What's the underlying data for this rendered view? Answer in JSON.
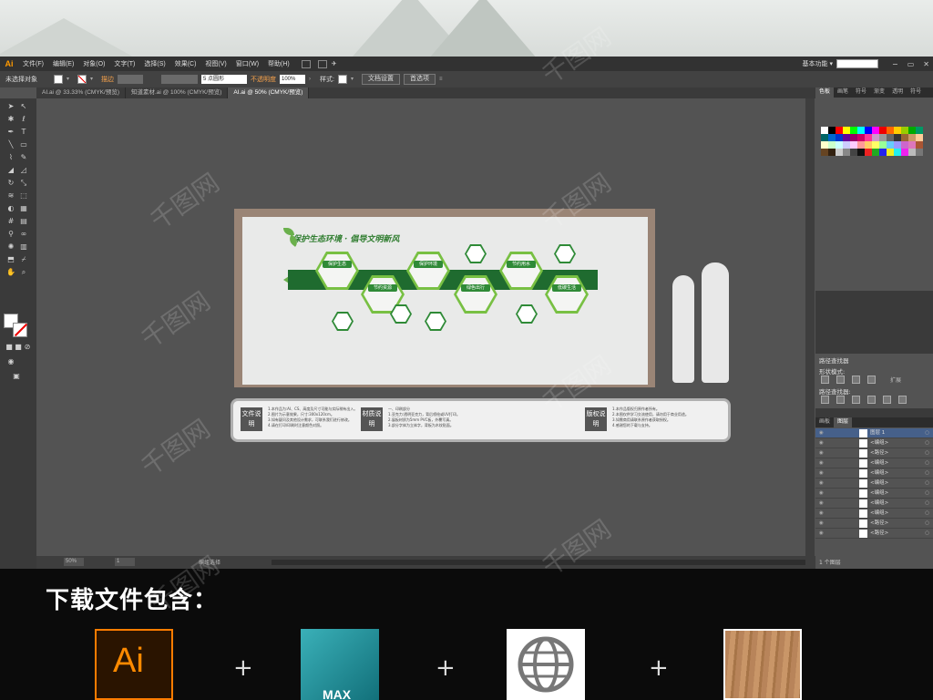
{
  "menubar": {
    "app_icon": "Ai",
    "items": [
      "文件(F)",
      "编辑(E)",
      "对象(O)",
      "文字(T)",
      "选择(S)",
      "效果(C)",
      "视图(V)",
      "窗口(W)",
      "帮助(H)"
    ],
    "workspace": "基本功能",
    "workspace_arrow": "▾"
  },
  "controlbar": {
    "selection": "未选择对象",
    "stroke_label": "描边",
    "stroke_units": "pt",
    "brush": "5 点圆形",
    "opacity_label": "不透明度",
    "opacity_value": "100%",
    "style_label": "样式:",
    "doc_setup": "文档设置",
    "prefs": "首选项"
  },
  "tabs": [
    {
      "label": "AI.ai @ 33.33% (CMYK/预览)",
      "active": false
    },
    {
      "label": "知道素材.ai @ 100% (CMYK/预览)",
      "active": false
    },
    {
      "label": "AI.ai @ 50% (CMYK/预览)",
      "active": true
    }
  ],
  "artwork": {
    "title": "保护生态环境 · 倡导文明新风",
    "hex_labels": [
      "保护生态",
      "节约资源",
      "保护环境",
      "绿色出行",
      "节约用水",
      "低碳生活"
    ]
  },
  "notes": [
    {
      "badge": "文件说明",
      "lines": [
        "1.本作品为:AI、CS、高度及尺寸可能与实际稍有出入。",
        "2.图片为示意效果，尺寸:300x120cm。",
        "3.如有疑问及其他设计需求，可联系我们进行修改。",
        "4.请在打印/印刷时注意颜色对照。"
      ]
    },
    {
      "badge": "材质说明",
      "lines": [
        "一、印刷部分",
        "1.亚克力:透明亚克力，背后喷绘或UV打印。",
        "2.展板材质为5mm PVC板，外覆写真。",
        "3.部分字体为立体字，背板为木纹贴面。"
      ]
    },
    {
      "badge": "版权说明",
      "lines": [
        "1.本作品版权归原作者所有。",
        "2.本图仅供学习交流使用，请勿用于商业用途。",
        "3.如需商用请联系原作者获取授权。",
        "4.感谢您的下载与支持。"
      ]
    }
  ],
  "statusbar": {
    "zoom": "50%",
    "page": "1",
    "status": "编组选择"
  },
  "panels": {
    "swatch_tabs": [
      "色板",
      "画笔",
      "符号",
      "渐变",
      "透明",
      "符号"
    ],
    "pathfinder_title": "路径查找器",
    "shape_modes": "形状模式:",
    "pathfinders": "路径查找器:",
    "expand": "扩展",
    "layer_tabs": [
      "图层",
      "画板"
    ],
    "layers": [
      {
        "name": "图层 1",
        "selected": true
      },
      {
        "name": "<编组>",
        "selected": false
      },
      {
        "name": "<路径>",
        "selected": false
      },
      {
        "name": "<编组>",
        "selected": false
      },
      {
        "name": "<编组>",
        "selected": false
      },
      {
        "name": "<编组>",
        "selected": false
      },
      {
        "name": "<编组>",
        "selected": false
      },
      {
        "name": "<编组>",
        "selected": false
      },
      {
        "name": "<编组>",
        "selected": false
      },
      {
        "name": "<路径>",
        "selected": false
      },
      {
        "name": "<路径>",
        "selected": false
      }
    ],
    "layer_count": "1 个图层"
  },
  "promo": {
    "title": "下载文件包含：",
    "ai_label": "Ai",
    "max_label": "MAX",
    "plus": "+"
  },
  "watermark": "千图网",
  "colors": {
    "accent": "#ff9a00",
    "green_dark": "#1f6b2f",
    "green_light": "#78c043",
    "frame": "#9a8576"
  },
  "icons": [
    "selection-tool-icon",
    "direct-select-icon",
    "pen-icon",
    "type-icon",
    "line-icon",
    "rect-icon",
    "brush-icon",
    "pencil-icon",
    "rotate-icon",
    "scale-icon",
    "width-icon",
    "free-transform-icon",
    "shape-builder-icon",
    "perspective-icon",
    "mesh-icon",
    "gradient-icon",
    "eyedropper-icon",
    "blend-icon",
    "symbol-sprayer-icon",
    "graph-icon",
    "artboard-icon",
    "slice-icon",
    "hand-icon",
    "zoom-icon"
  ]
}
